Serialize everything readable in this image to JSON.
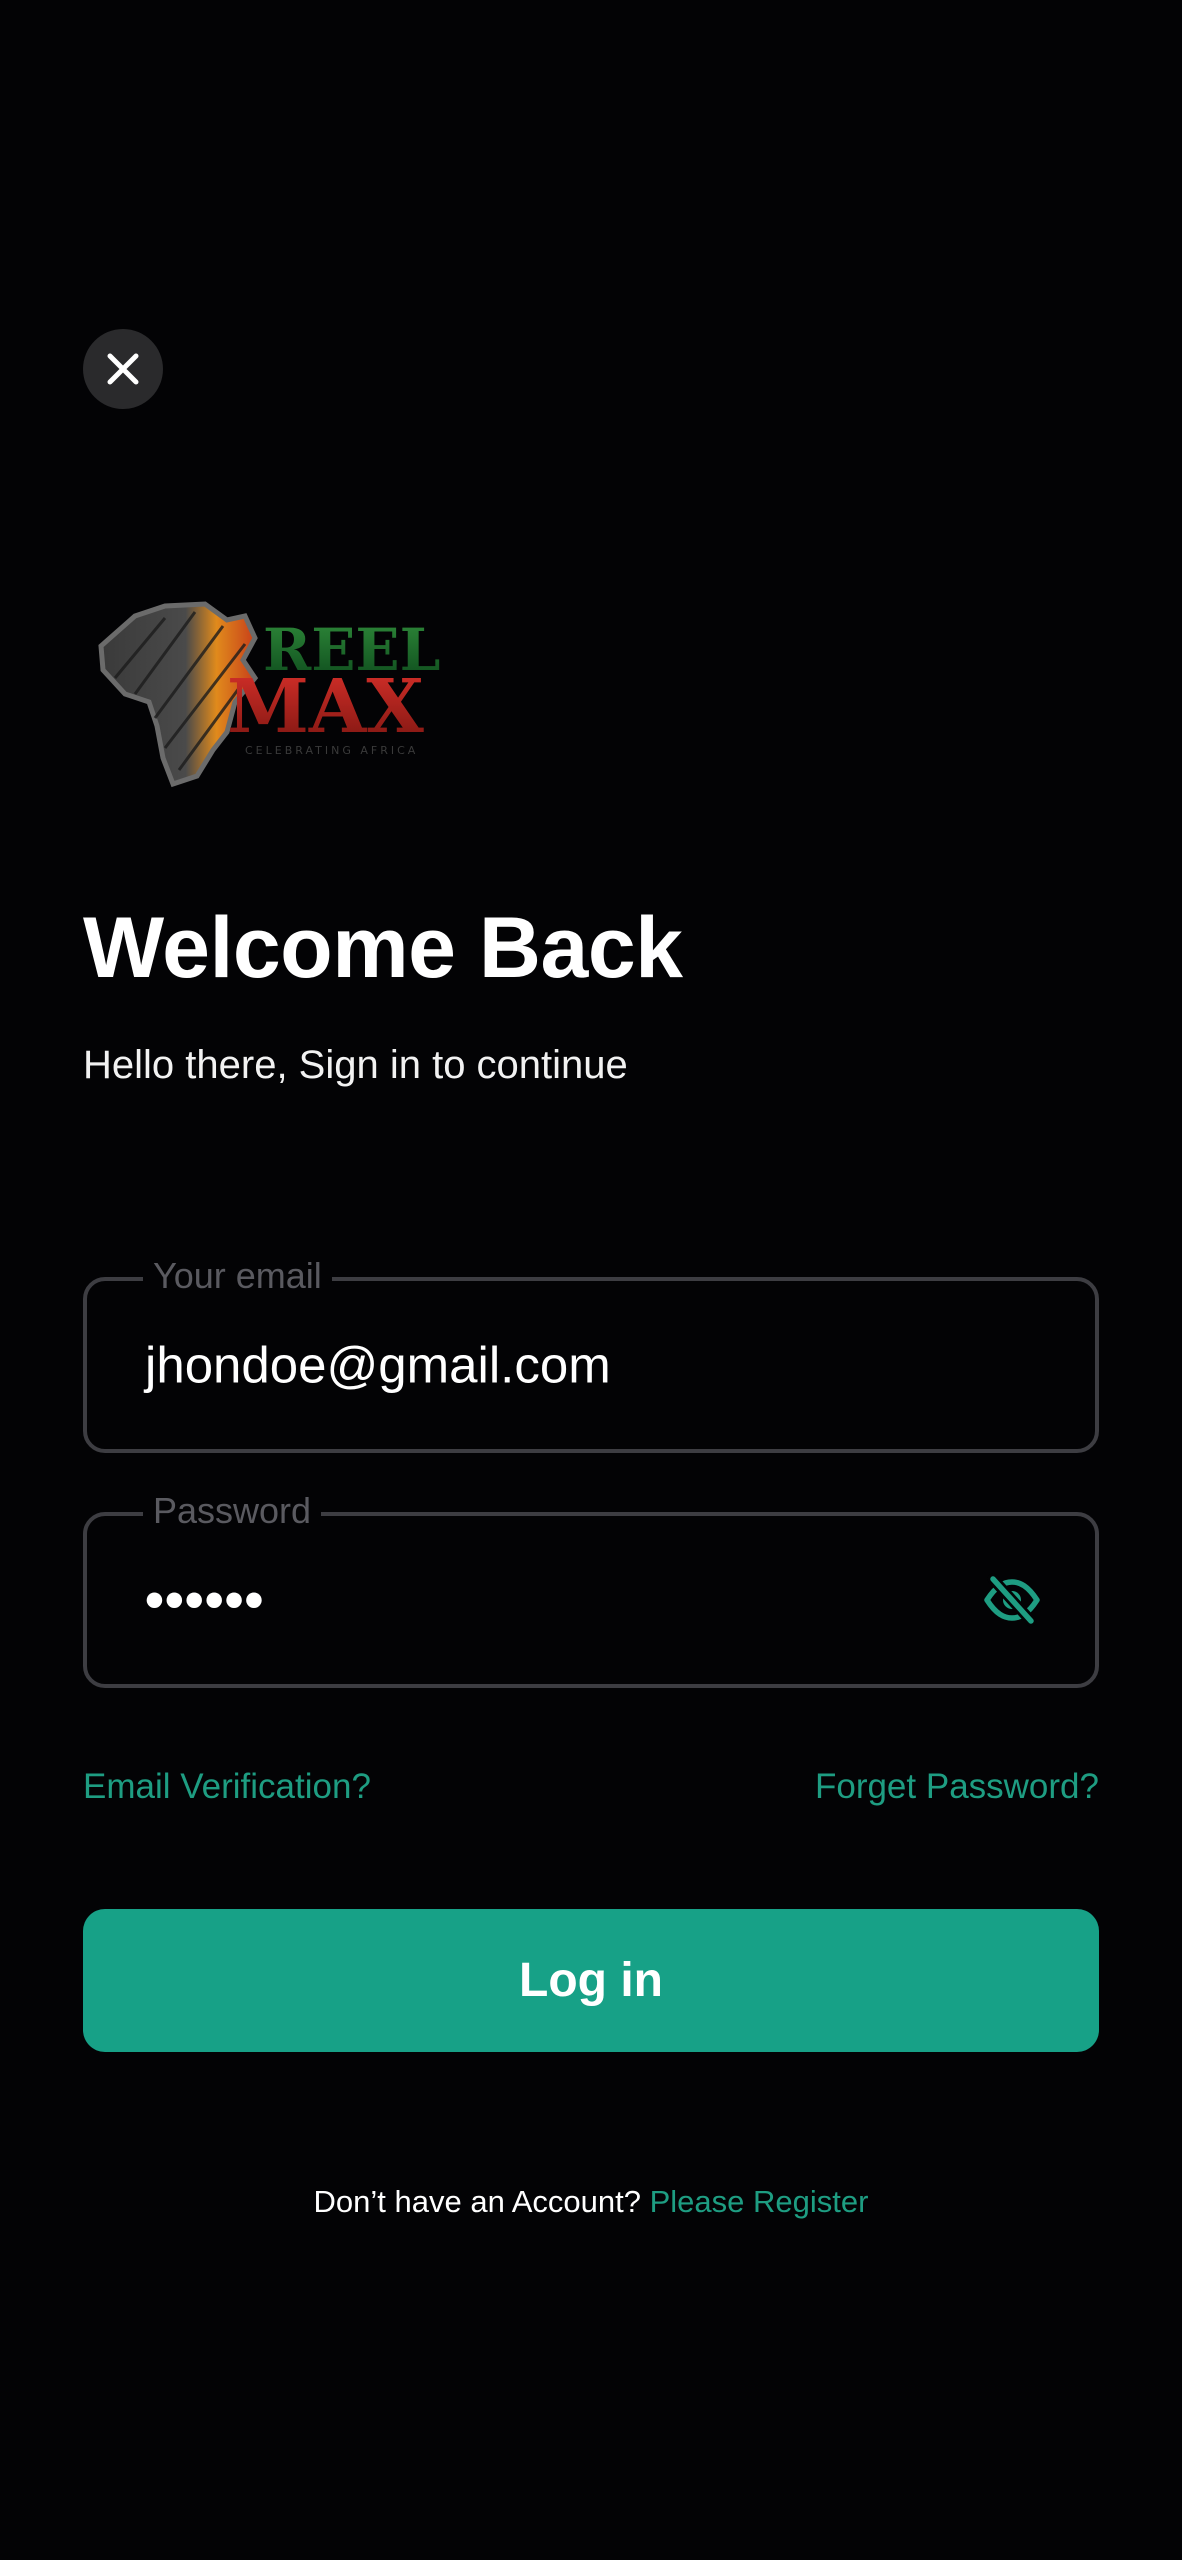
{
  "close_button": {
    "icon": "close-icon"
  },
  "logo": {
    "brand_line1": "REEL",
    "brand_line2": "MAX",
    "tagline": "CELEBRATING AFRICA"
  },
  "header": {
    "title": "Welcome Back",
    "subtitle": "Hello there, Sign in to continue"
  },
  "email_field": {
    "label": "Your email",
    "value": "jhondoe@gmail.com"
  },
  "password_field": {
    "label": "Password",
    "value": "••••••",
    "toggle_icon": "eye-off-icon"
  },
  "links": {
    "email_verification": "Email Verification?",
    "forget_password": "Forget Password?"
  },
  "login_button": {
    "label": "Log in"
  },
  "register": {
    "prompt": "Don’t have an Account?",
    "link": "Please Register"
  },
  "colors": {
    "background": "#030305",
    "accent": "#17a187",
    "link": "#1e9d82",
    "field_border": "#3d3d42",
    "close_bg": "#2a2a2c"
  }
}
